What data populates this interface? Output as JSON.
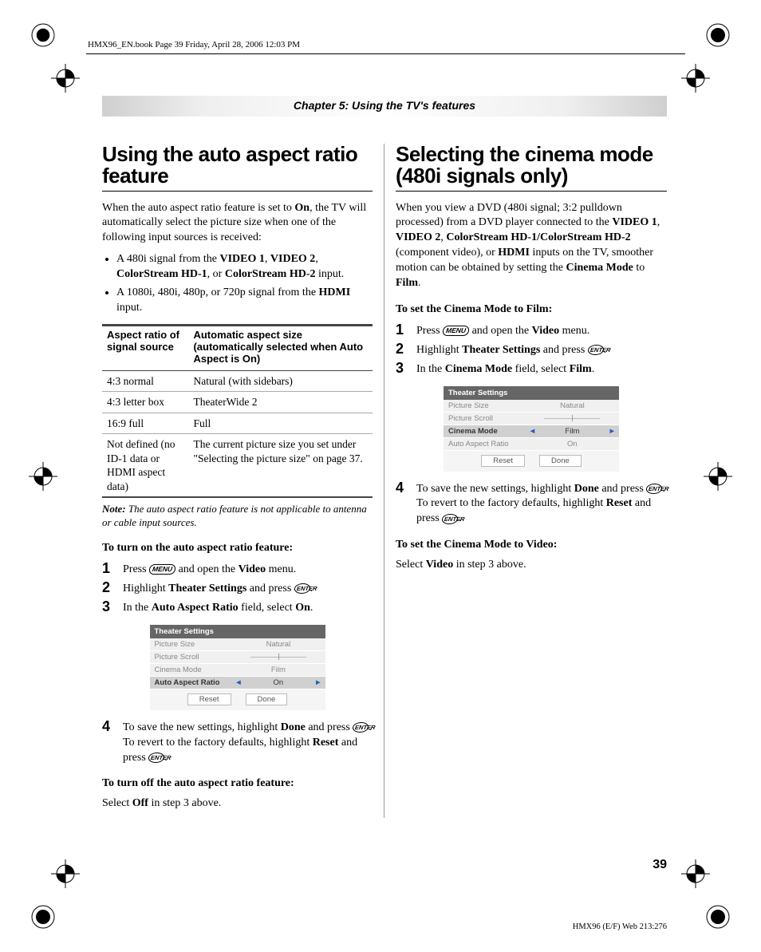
{
  "header_line": "HMX96_EN.book  Page 39  Friday, April 28, 2006  12:03 PM",
  "chapter_banner": "Chapter 5: Using the TV's features",
  "left": {
    "h1": "Using the auto aspect ratio feature",
    "intro_pre": "When the auto aspect ratio feature is set to ",
    "intro_bold": "On",
    "intro_post": ", the TV will automatically select the picture size when one of the following input sources is received:",
    "bullet1_a": "A 480i signal from the ",
    "bullet1_v1": "VIDEO 1",
    "bullet1_v2": "VIDEO 2",
    "bullet1_cs1": "ColorStream HD-1",
    "bullet1_or": ", or ",
    "bullet1_cs2": "ColorStream HD-2",
    "bullet1_end": " input.",
    "bullet2_a": "A 1080i, 480i, 480p, or 720p signal from the ",
    "bullet2_hdmi": "HDMI",
    "bullet2_end": " input.",
    "table": {
      "th1": "Aspect ratio of signal source",
      "th2": "Automatic aspect size (automatically selected when Auto Aspect is On)",
      "r1c1": "4:3 normal",
      "r1c2": "Natural (with sidebars)",
      "r2c1": "4:3 letter box",
      "r2c2": "TheaterWide 2",
      "r3c1": "16:9 full",
      "r3c2": "Full",
      "r4c1": "Not defined (no ID-1 data or HDMI aspect data)",
      "r4c2": "The current picture size you set under \"Selecting the picture size\" on page 37."
    },
    "note_label": "Note:",
    "note_text": " The auto aspect ratio feature is not applicable to antenna or cable input sources.",
    "sub_on": "To turn on the auto aspect ratio feature:",
    "s1_a": "Press ",
    "menu_label": "MENU",
    "s1_b": " and open the ",
    "s1_video": "Video",
    "s1_c": " menu.",
    "s2_a": "Highlight ",
    "s2_ts": "Theater Settings",
    "s2_b": " and press ",
    "enter_label": "ENTER",
    "s2_c": ".",
    "s3_a": "In the ",
    "s3_aar": "Auto Aspect Ratio",
    "s3_b": " field, select ",
    "s3_on": "On",
    "s3_c": ".",
    "menu": {
      "title": "Theater Settings",
      "r1l": "Picture Size",
      "r1v": "Natural",
      "r2l": "Picture Scroll",
      "r3l": "Cinema Mode",
      "r3v": "Film",
      "r4l": "Auto Aspect Ratio",
      "r4v": "On",
      "btn_reset": "Reset",
      "btn_done": "Done"
    },
    "s4_a": "To save the new settings, highlight ",
    "s4_done": "Done",
    "s4_b": " and press ",
    "s4_c": ". To revert to the factory defaults, highlight ",
    "s4_reset": "Reset",
    "s4_d": " and press ",
    "s4_e": ".",
    "sub_off": "To turn off the auto aspect ratio feature:",
    "off_a": "Select ",
    "off_b": "Off",
    "off_c": " in step 3 above."
  },
  "right": {
    "h1": "Selecting the cinema mode (480i signals only)",
    "intro_a": "When you view a DVD (480i signal; 3:2 pulldown processed) from a DVD player connected to the ",
    "v1": "VIDEO 1",
    "v2": "VIDEO 2",
    "cs": "ColorStream HD-1/ColorStream HD-2",
    "intro_b": " (component video), or ",
    "hdmi": "HDMI",
    "intro_c": " inputs on the TV, smoother motion can be obtained by setting the ",
    "cmode": "Cinema Mode",
    "intro_d": " to ",
    "film": "Film",
    "intro_e": ".",
    "sub_film": "To set the Cinema Mode to Film:",
    "s1_a": "Press ",
    "s1_b": " and open the ",
    "s1_video": "Video",
    "s1_c": " menu.",
    "s2_a": "Highlight ",
    "s2_ts": "Theater Settings",
    "s2_b": " and press ",
    "s2_c": ".",
    "s3_a": "In the ",
    "s3_cm": "Cinema Mode",
    "s3_b": " field, select ",
    "s3_film": "Film",
    "s3_c": ".",
    "menu": {
      "title": "Theater Settings",
      "r1l": "Picture Size",
      "r1v": "Natural",
      "r2l": "Picture Scroll",
      "r3l": "Cinema Mode",
      "r3v": "Film",
      "r4l": "Auto Aspect Ratio",
      "r4v": "On",
      "btn_reset": "Reset",
      "btn_done": "Done"
    },
    "s4_a": "To save the new settings, highlight ",
    "s4_done": "Done",
    "s4_b": " and press ",
    "s4_c": ". To revert to the factory defaults, highlight ",
    "s4_reset": "Reset",
    "s4_d": " and press ",
    "s4_e": ".",
    "sub_video": "To set the Cinema Mode to Video:",
    "vid_a": "Select ",
    "vid_b": "Video",
    "vid_c": " in step 3 above."
  },
  "page_number": "39",
  "footer_code": "HMX96 (E/F) Web 213:276",
  "nums": {
    "1": "1",
    "2": "2",
    "3": "3",
    "4": "4"
  }
}
